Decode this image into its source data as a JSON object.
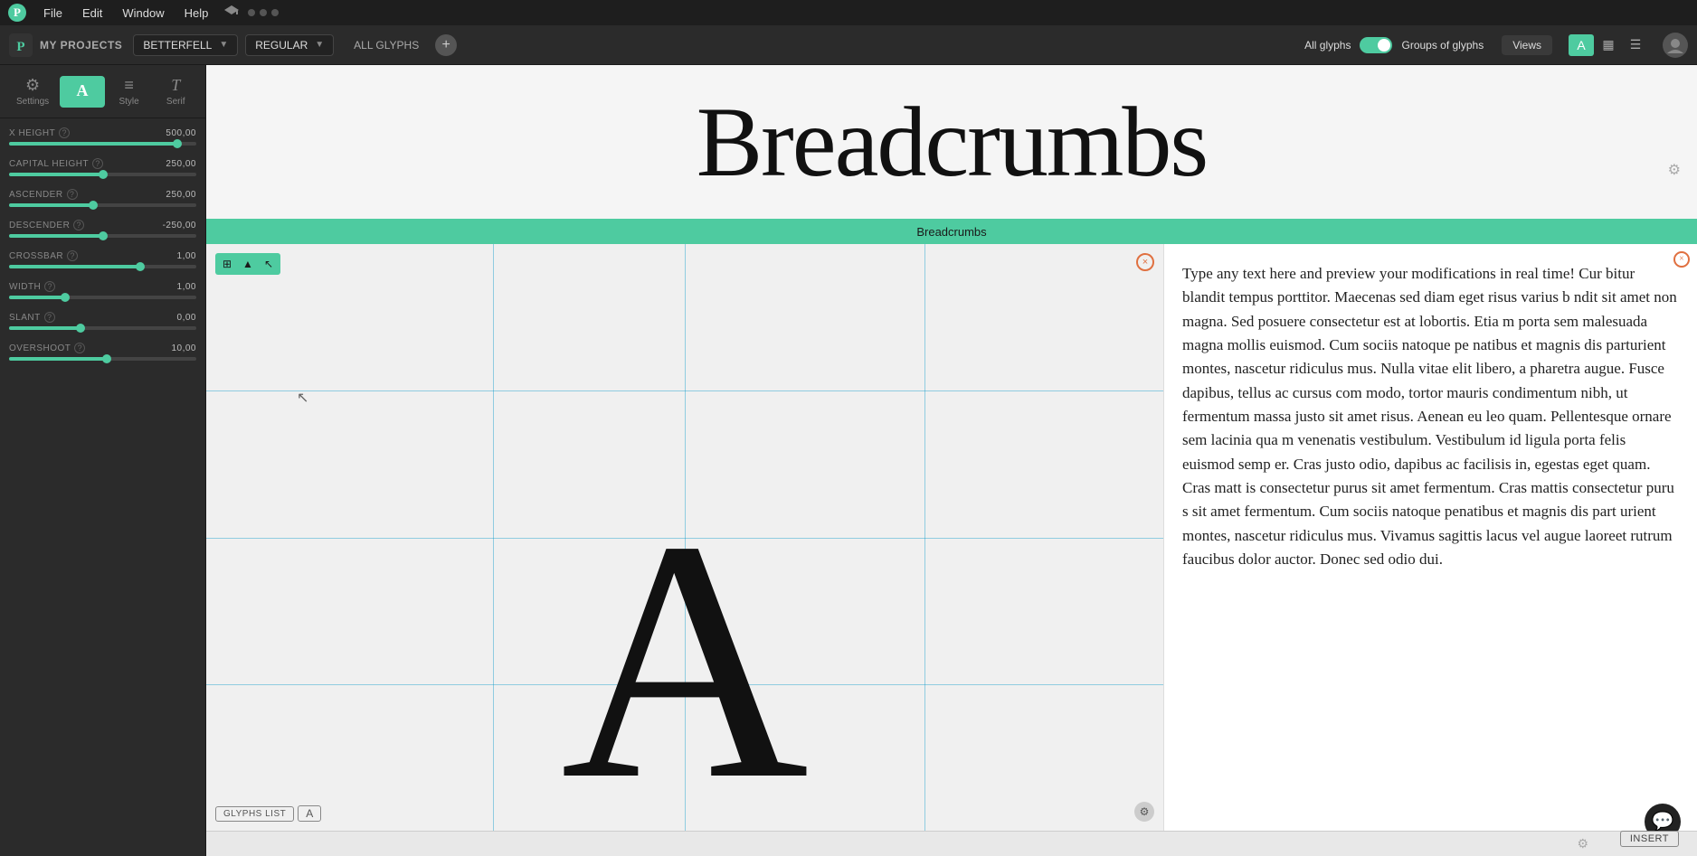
{
  "menu": {
    "logo": "P",
    "items": [
      "File",
      "Edit",
      "Window",
      "Help"
    ],
    "dots": 3
  },
  "toolbar": {
    "project_label": "MY PROJECTS",
    "font_name": "BETTERFELL",
    "font_weight": "REGULAR",
    "tab_label": "ALL GLYPHS",
    "add_icon": "+",
    "all_glyphs_label": "All glyphs",
    "groups_label": "Groups of glyphs",
    "views_label": "Views",
    "view_icons": [
      "A",
      "▦",
      "☰"
    ],
    "active_view": 0
  },
  "sidebar": {
    "icons": [
      {
        "id": "settings",
        "symbol": "⚙",
        "label": "Settings"
      },
      {
        "id": "glyph",
        "symbol": "A",
        "label": ""
      },
      {
        "id": "style",
        "symbol": "≡≡",
        "label": "Style"
      },
      {
        "id": "serif",
        "symbol": "T",
        "label": "Serif"
      }
    ],
    "active_icon": 1,
    "params": [
      {
        "id": "x-height",
        "label": "X HEIGHT",
        "value": "500,00",
        "fill_pct": 90,
        "thumb_pct": 90
      },
      {
        "id": "capital-height",
        "label": "CAPITAL HEIGHT",
        "value": "250,00",
        "fill_pct": 50,
        "thumb_pct": 50
      },
      {
        "id": "ascender",
        "label": "ASCENDER",
        "value": "250,00",
        "fill_pct": 45,
        "thumb_pct": 45
      },
      {
        "id": "descender",
        "label": "DESCENDER",
        "value": "-250,00",
        "fill_pct": 50,
        "thumb_pct": 50
      },
      {
        "id": "crossbar",
        "label": "CROSSBAR",
        "value": "1,00",
        "fill_pct": 70,
        "thumb_pct": 70
      },
      {
        "id": "width",
        "label": "WIDTH",
        "value": "1,00",
        "fill_pct": 30,
        "thumb_pct": 30
      },
      {
        "id": "slant",
        "label": "SLANT",
        "value": "0,00",
        "fill_pct": 38,
        "thumb_pct": 38
      },
      {
        "id": "overshoot",
        "label": "OVERSHOOT",
        "value": "10,00",
        "fill_pct": 52,
        "thumb_pct": 52
      }
    ]
  },
  "canvas": {
    "preview_text": "Breadcrumbs",
    "breadcrumb_bar_text": "Breadcrumbs",
    "glyph_char": "A",
    "glyphs_list_btn": "GLYPHS LIST",
    "glyph_char_btn": "A",
    "insert_btn": "INSERT",
    "close_label": "×",
    "overlay_btns": [
      "⊞",
      "▲",
      "↖"
    ]
  },
  "text_preview": {
    "content": "Type any text here and preview your modifications in real time! Cur bitur blandit tempus porttitor. Maecenas sed diam eget risus varius b ndit sit amet non magna. Sed posuere consectetur est at lobortis. Etia m porta sem malesuada magna mollis euismod. Cum sociis natoque pe natibus et magnis dis parturient montes, nascetur ridiculus mus. Nulla vitae elit libero, a pharetra augue. Fusce dapibus, tellus ac cursus com modo, tortor mauris condimentum nibh, ut fermentum massa justo sit amet risus. Aenean eu leo quam. Pellentesque ornare sem lacinia qua m venenatis vestibulum. Vestibulum id ligula porta felis euismod semp er. Cras justo odio, dapibus ac facilisis in, egestas eget quam. Cras matt is consectetur purus sit amet fermentum. Cras mattis consectetur puru s sit amet fermentum. Cum sociis natoque penatibus et magnis dis part urient montes, nascetur ridiculus mus. Vivamus sagittis lacus vel augue laoreet rutrum faucibus dolor auctor. Donec sed odio dui."
  },
  "colors": {
    "accent": "#4ecba0",
    "bg_dark": "#2b2b2b",
    "bg_darker": "#1e1e1e",
    "canvas_bg": "#f0f0f0",
    "preview_bg": "#f5f5f5",
    "close_color": "#e07040"
  },
  "chat_icon": "💬"
}
